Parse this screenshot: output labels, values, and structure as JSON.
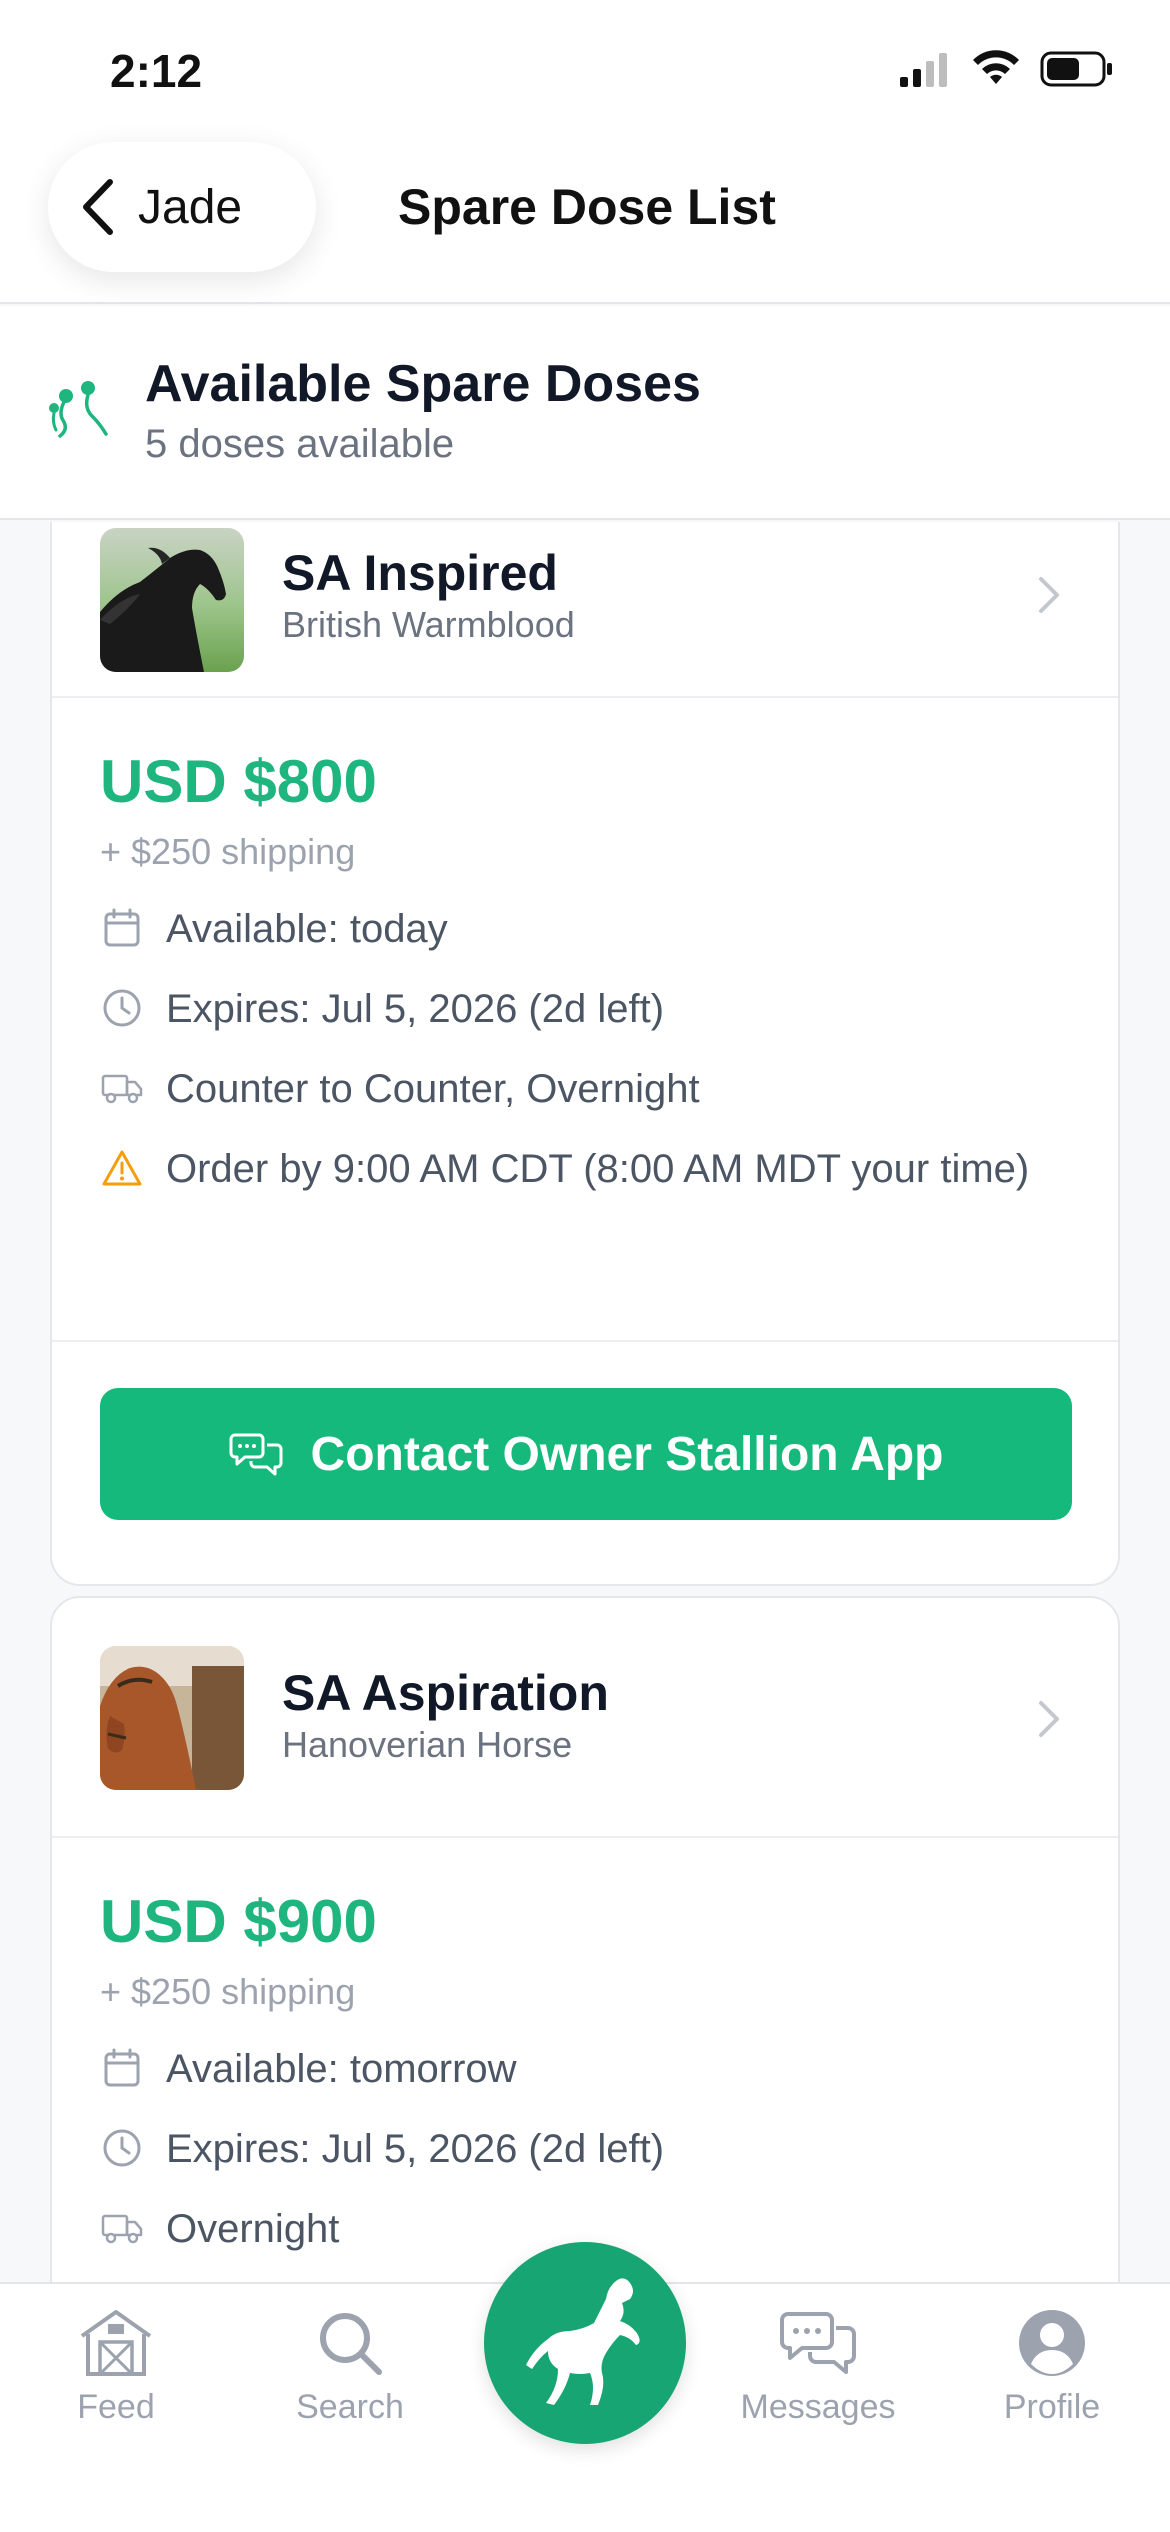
{
  "status_bar": {
    "time": "2:12"
  },
  "nav": {
    "back_label": "Jade",
    "title": "Spare Dose List"
  },
  "section": {
    "title": "Available Spare Doses",
    "subtitle": "5 doses available"
  },
  "listings": [
    {
      "name": "SA Inspired",
      "breed": "British Warmblood",
      "price": "USD $800",
      "shipping": "+ $250 shipping",
      "available": "Available: today",
      "expires": "Expires: Jul 5, 2026 (2d left)",
      "shipping_method": "Counter to Counter, Overnight",
      "order_by": "Order by 9:00 AM CDT (8:00 AM MDT your time)",
      "contact_label": "Contact Owner Stallion App"
    },
    {
      "name": "SA Aspiration",
      "breed": "Hanoverian Horse",
      "price": "USD $900",
      "shipping": "+ $250 shipping",
      "available": "Available: tomorrow",
      "expires": "Expires: Jul 5, 2026 (2d left)",
      "shipping_method": "Overnight"
    }
  ],
  "tabs": {
    "feed": "Feed",
    "search": "Search",
    "messages": "Messages",
    "profile": "Profile"
  },
  "colors": {
    "accent": "#16b97c",
    "price": "#1fb57f",
    "warning": "#f59e0b"
  },
  "icons": [
    "chevron-left-icon",
    "sperm-icon",
    "chevron-right-icon",
    "calendar-icon",
    "clock-icon",
    "truck-icon",
    "warning-icon",
    "chat-icon",
    "barn-icon",
    "search-icon",
    "horse-icon",
    "messages-icon",
    "profile-icon"
  ]
}
